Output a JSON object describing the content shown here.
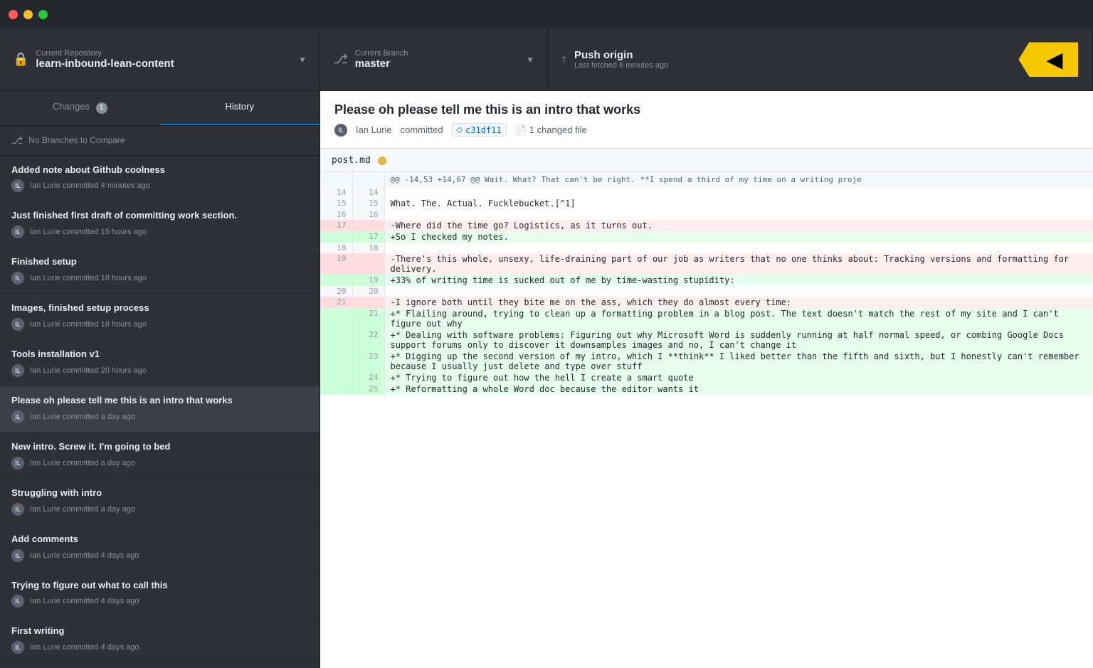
{
  "titlebar": {
    "buttons": [
      "close",
      "minimize",
      "maximize"
    ]
  },
  "toolbar": {
    "repo": {
      "label": "Current Repository",
      "value": "learn-inbound-lean-content",
      "icon": "lock"
    },
    "branch": {
      "label": "Current Branch",
      "value": "master",
      "icon": "branch"
    },
    "push": {
      "label": "Push origin",
      "sublabel": "Last fetched 6 minutes ago",
      "icon": "push"
    }
  },
  "left_panel": {
    "tabs": [
      {
        "id": "changes",
        "label": "Changes",
        "badge": "1",
        "active": false
      },
      {
        "id": "history",
        "label": "History",
        "badge": null,
        "active": true
      }
    ],
    "branch_compare": "No Branches to Compare",
    "commits": [
      {
        "title": "Added note about Github coolness",
        "author": "Ian Lurie",
        "time": "committed 4 minutes ago",
        "selected": false
      },
      {
        "title": "Just finished first draft of committing work section.",
        "author": "Ian Lurie",
        "time": "committed 15 hours ago",
        "selected": false
      },
      {
        "title": "Finished setup",
        "author": "Ian Lurie",
        "time": "committed 18 hours ago",
        "selected": false
      },
      {
        "title": "Images, finished setup process",
        "author": "Ian Lurie",
        "time": "committed 18 hours ago",
        "selected": false
      },
      {
        "title": "Tools installation v1",
        "author": "Ian Lurie",
        "time": "committed 20 hours ago",
        "selected": false
      },
      {
        "title": "Please oh please tell me this is an intro that works",
        "author": "Ian Lurie",
        "time": "committed a day ago",
        "selected": true
      },
      {
        "title": "New intro. Screw it. I'm going to bed",
        "author": "Ian Lurie",
        "time": "committed a day ago",
        "selected": false
      },
      {
        "title": "Struggling with intro",
        "author": "Ian Lurie",
        "time": "committed a day ago",
        "selected": false
      },
      {
        "title": "Add comments",
        "author": "Ian Lurie",
        "time": "committed 4 days ago",
        "selected": false
      },
      {
        "title": "Trying to figure out what to call this",
        "author": "Ian Lurie",
        "time": "committed 4 days ago",
        "selected": false
      },
      {
        "title": "First writing",
        "author": "Ian Lurie",
        "time": "committed 4 days ago",
        "selected": false
      }
    ]
  },
  "right_panel": {
    "commit_title": "Please oh please tell me this is an intro that works",
    "commit_author": "Ian Lurie",
    "commit_action": "committed",
    "commit_hash": "c31df11",
    "changed_files": "1 changed file",
    "file": "post.md",
    "diff_header": "@@ -14,53 +14,67 @@ Wait. What? That can't be right. **I spend a third of my time on a writing proje",
    "diff_lines": [
      {
        "type": "context",
        "left_num": "14",
        "right_num": "14",
        "content": ""
      },
      {
        "type": "context",
        "left_num": "15",
        "right_num": "15",
        "content": "What. The. Actual. Fucklebucket.[^1]"
      },
      {
        "type": "context",
        "left_num": "16",
        "right_num": "16",
        "content": ""
      },
      {
        "type": "removed",
        "left_num": "17",
        "right_num": "",
        "content": "-Where did the time go? Logistics, as it turns out."
      },
      {
        "type": "added",
        "left_num": "",
        "right_num": "17",
        "content": "+So I checked my notes."
      },
      {
        "type": "context",
        "left_num": "18",
        "right_num": "18",
        "content": ""
      },
      {
        "type": "removed",
        "left_num": "19",
        "right_num": "",
        "content": "-There's this whole, unsexy, life-draining part of our job as writers that no one thinks about: Tracking versions and formatting for delivery."
      },
      {
        "type": "added",
        "left_num": "",
        "right_num": "19",
        "content": "+33% of writing time is sucked out of me by time-wasting stupidity:"
      },
      {
        "type": "context",
        "left_num": "20",
        "right_num": "20",
        "content": ""
      },
      {
        "type": "removed",
        "left_num": "21",
        "right_num": "",
        "content": "-I ignore both until they bite me on the ass, which they do almost every time:"
      },
      {
        "type": "added",
        "left_num": "",
        "right_num": "21",
        "content": "+* Flailing around, trying to clean up a formatting problem in a blog post. The text doesn't match the rest of my site and I can't figure out why"
      },
      {
        "type": "added",
        "left_num": "",
        "right_num": "22",
        "content": "+* Dealing with software problems: Figuring out why Microsoft Word is suddenly running at half normal speed, or combing Google Docs support forums only to discover it downsamples images and no, I can't change it"
      },
      {
        "type": "added",
        "left_num": "",
        "right_num": "23",
        "content": "+* Digging up the second version of my intro, which I **think** I liked better than the fifth and sixth, but I honestly can't remember because I usually just delete and type over stuff"
      },
      {
        "type": "added",
        "left_num": "",
        "right_num": "24",
        "content": "+* Trying to figure out how the hell I create a smart quote"
      },
      {
        "type": "added",
        "left_num": "",
        "right_num": "25",
        "content": "+* Reformatting a whole Word doc because the editor wants it"
      }
    ]
  },
  "colors": {
    "accent_blue": "#0075ca",
    "yellow_arrow": "#f5c800",
    "removed_bg": "#ffeef0",
    "added_bg": "#e6ffed"
  }
}
